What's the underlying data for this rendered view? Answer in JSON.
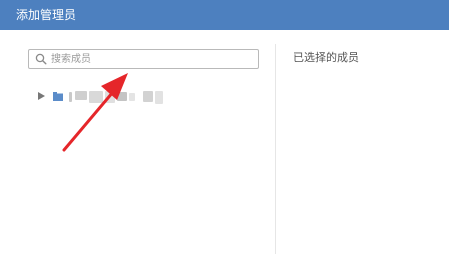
{
  "dialog": {
    "title": "添加管理员"
  },
  "search": {
    "placeholder": "搜索成员",
    "value": ""
  },
  "tree": {
    "root_expanded": false
  },
  "selected": {
    "label": "已选择的成员"
  },
  "colors": {
    "header_bg": "#4d80bf",
    "header_text": "#ffffff",
    "folder": "#5b8cc9",
    "annotation_arrow": "#e5262a"
  },
  "icons": {
    "search": "search-icon",
    "expand": "caret-right-icon",
    "folder": "folder-icon",
    "annotation": "red-arrow-icon"
  }
}
